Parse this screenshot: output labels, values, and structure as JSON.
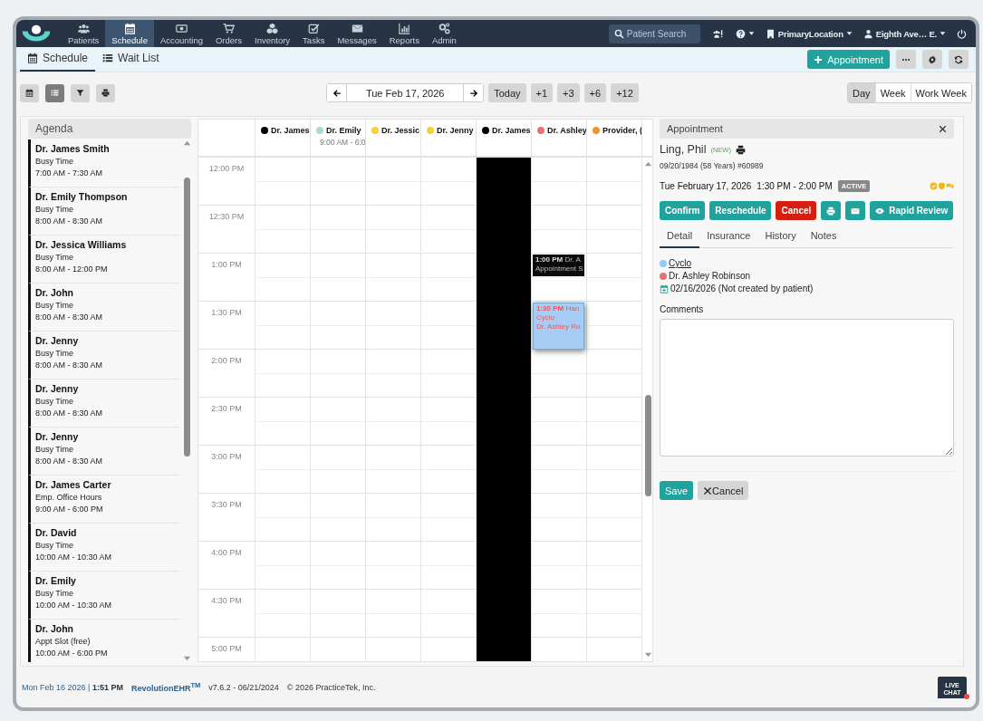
{
  "nav": {
    "items": [
      {
        "label": "Patients",
        "selected": false
      },
      {
        "label": "Schedule",
        "selected": true
      },
      {
        "label": "Accounting",
        "selected": false
      },
      {
        "label": "Orders",
        "selected": false
      },
      {
        "label": "Inventory",
        "selected": false
      },
      {
        "label": "Tasks",
        "selected": false
      },
      {
        "label": "Messages",
        "selected": false
      },
      {
        "label": "Reports",
        "selected": false
      },
      {
        "label": "Admin",
        "selected": false
      }
    ],
    "search": {
      "placeholder": "Patient Search"
    },
    "location": "PrimaryLocation",
    "user": "Eighth Ave… E."
  },
  "subnav": {
    "tabs": [
      {
        "label": "Schedule",
        "selected": true
      },
      {
        "label": "Wait List",
        "selected": false
      }
    ],
    "new_button": "Appointment"
  },
  "toolbar": {
    "view_buttons": [
      {
        "selected": false
      },
      {
        "selected": true
      },
      {
        "selected": false
      },
      {
        "selected": false
      }
    ],
    "date": "Tue Feb 17, 2026",
    "jump_buttons": [
      "Today",
      "+1",
      "+3",
      "+6",
      "+12"
    ],
    "ranges": [
      {
        "label": "Day",
        "selected": true
      },
      {
        "label": "Week",
        "selected": false
      },
      {
        "label": "Work Week",
        "selected": false
      }
    ]
  },
  "agenda": {
    "title": "Agenda",
    "items": [
      {
        "name": "Dr. James Smith",
        "type": "Busy Time",
        "time": "7:00 AM - 7:30 AM"
      },
      {
        "name": "Dr. Emily Thompson",
        "type": "Busy Time",
        "time": "8:00 AM - 8:30 AM"
      },
      {
        "name": "Dr. Jessica Williams",
        "type": "Busy Time",
        "time": "8:00 AM - 12:00 PM"
      },
      {
        "name": "Dr. John",
        "type": "Busy Time",
        "time": "8:00 AM - 8:30 AM"
      },
      {
        "name": "Dr. Jenny",
        "type": "Busy Time",
        "time": "8:00 AM - 8:30 AM"
      },
      {
        "name": "Dr. Jenny",
        "type": "Busy Time",
        "time": "8:00 AM - 8:30 AM"
      },
      {
        "name": "Dr. Jenny",
        "type": "Busy Time",
        "time": "8:00 AM - 8:30 AM"
      },
      {
        "name": "Dr. James Carter",
        "type": "Emp. Office Hours",
        "time": "9:00 AM - 6:00 PM"
      },
      {
        "name": "Dr. David",
        "type": "Busy Time",
        "time": "10:00 AM - 10:30 AM"
      },
      {
        "name": "Dr. Emily",
        "type": "Busy Time",
        "time": "10:00 AM - 10:30 AM"
      },
      {
        "name": "Dr. John",
        "type": "Appt Slot (free)",
        "time": "10:00 AM - 6:00 PM"
      }
    ]
  },
  "calendar": {
    "providers": [
      {
        "name": "Dr. James",
        "color": "#000000",
        "blocked": false
      },
      {
        "name": "Dr. Emily",
        "color": "#a8dadc",
        "hours": "9:00 AM - 6:0",
        "blocked": false
      },
      {
        "name": "Dr. Jessic",
        "color": "#f9cf3a",
        "blocked": false
      },
      {
        "name": "Dr. Jenny",
        "color": "#f9cf3a",
        "blocked": false
      },
      {
        "name": "Dr. James",
        "color": "#000000",
        "blocked": true
      },
      {
        "name": "Dr. Ashley",
        "color": "#e57373",
        "blocked": false,
        "schedule": [
          {
            "kind": "free"
          },
          {
            "kind": "free"
          },
          {
            "kind": "block",
            "time": "1:00 PM",
            "title": "Dr. A",
            "lines": [
              "Appointment S"
            ],
            "selected": false
          },
          {
            "kind": "appointment",
            "time": "1:30 PM",
            "title": "Han",
            "lines": [
              "Cyclo",
              "Dr. Ashley Ro"
            ],
            "selected": true
          }
        ]
      },
      {
        "name": "Provider, (",
        "color": "#f0932b",
        "blocked": false
      }
    ],
    "rows": [
      "12:00 PM",
      "12:30 PM",
      "1:00 PM",
      "1:30 PM",
      "2:00 PM",
      "2:30 PM",
      "3:00 PM",
      "3:30 PM",
      "4:00 PM",
      "4:30 PM",
      "5:00 PM"
    ]
  },
  "appointment": {
    "title": "Appointment",
    "patient": "Ling, Phil",
    "badge": "(NEW)",
    "details": "09/20/1984 (58 Years) #60989",
    "date": "Tue February 17, 2026",
    "time": "1:30 PM - 2:00 PM",
    "status": "ACTIVE",
    "actions": [
      {
        "kind": "primary",
        "label": "Confirm"
      },
      {
        "kind": "primary",
        "label": "Reschedule"
      },
      {
        "kind": "danger",
        "label": "Cancel"
      },
      {
        "kind": "print"
      },
      {
        "kind": "email"
      },
      {
        "kind": "review",
        "label": "Rapid Review"
      }
    ],
    "tabs": [
      {
        "label": "Detail",
        "selected": true
      },
      {
        "label": "Insurance",
        "selected": false
      },
      {
        "label": "History",
        "selected": false
      },
      {
        "label": "Notes",
        "selected": false
      }
    ],
    "encounter_type": {
      "text": "Cyclo",
      "color": "#90caf9"
    },
    "provider": {
      "text": "Dr. Ashley Robinson",
      "color": "#e57373"
    },
    "created": "02/16/2026 (Not created by patient)",
    "comments_label": "Comments",
    "save": "Save",
    "cancel": "Cancel"
  },
  "status_bar": {
    "datetime": "Mon Feb 16 2026 | **1:51 PM**",
    "product": "RevolutionEHR$^{TM}$",
    "version": "v7.6.2 - 06/21/2024",
    "copyright": "© 2026 PracticeTek, Inc."
  },
  "live_chat": "LIVE CHAT"
}
